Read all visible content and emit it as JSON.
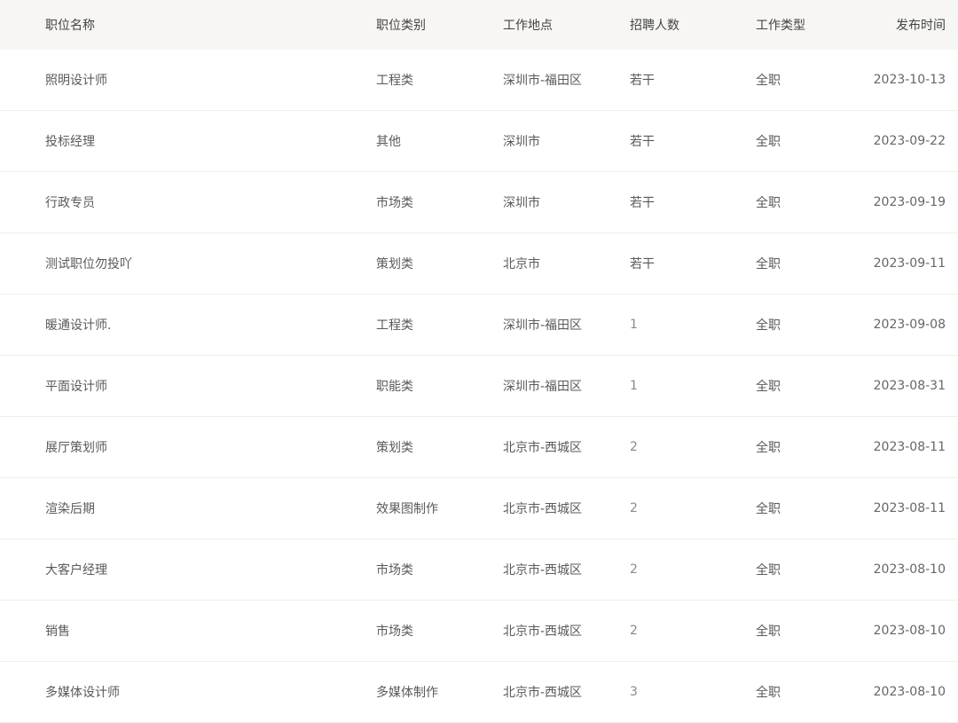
{
  "table": {
    "headers": [
      "职位名称",
      "职位类别",
      "工作地点",
      "招聘人数",
      "工作类型",
      "发布时间"
    ],
    "rows": [
      [
        "照明设计师",
        "工程类",
        "深圳市-福田区",
        "若干",
        "全职",
        "2023-10-13"
      ],
      [
        "投标经理",
        "其他",
        "深圳市",
        "若干",
        "全职",
        "2023-09-22"
      ],
      [
        "行政专员",
        "市场类",
        "深圳市",
        "若干",
        "全职",
        "2023-09-19"
      ],
      [
        "测试职位勿投吖",
        "策划类",
        "北京市",
        "若干",
        "全职",
        "2023-09-11"
      ],
      [
        "暖通设计师.",
        "工程类",
        "深圳市-福田区",
        "1",
        "全职",
        "2023-09-08"
      ],
      [
        "平面设计师",
        "职能类",
        "深圳市-福田区",
        "1",
        "全职",
        "2023-08-31"
      ],
      [
        "展厅策划师",
        "策划类",
        "北京市-西城区",
        "2",
        "全职",
        "2023-08-11"
      ],
      [
        "渲染后期",
        "效果图制作",
        "北京市-西城区",
        "2",
        "全职",
        "2023-08-11"
      ],
      [
        "大客户经理",
        "市场类",
        "北京市-西城区",
        "2",
        "全职",
        "2023-08-10"
      ],
      [
        "销售",
        "市场类",
        "北京市-西城区",
        "2",
        "全职",
        "2023-08-10"
      ],
      [
        "多媒体设计师",
        "多媒体制作",
        "北京市-西城区",
        "3",
        "全职",
        "2023-08-10"
      ]
    ]
  }
}
